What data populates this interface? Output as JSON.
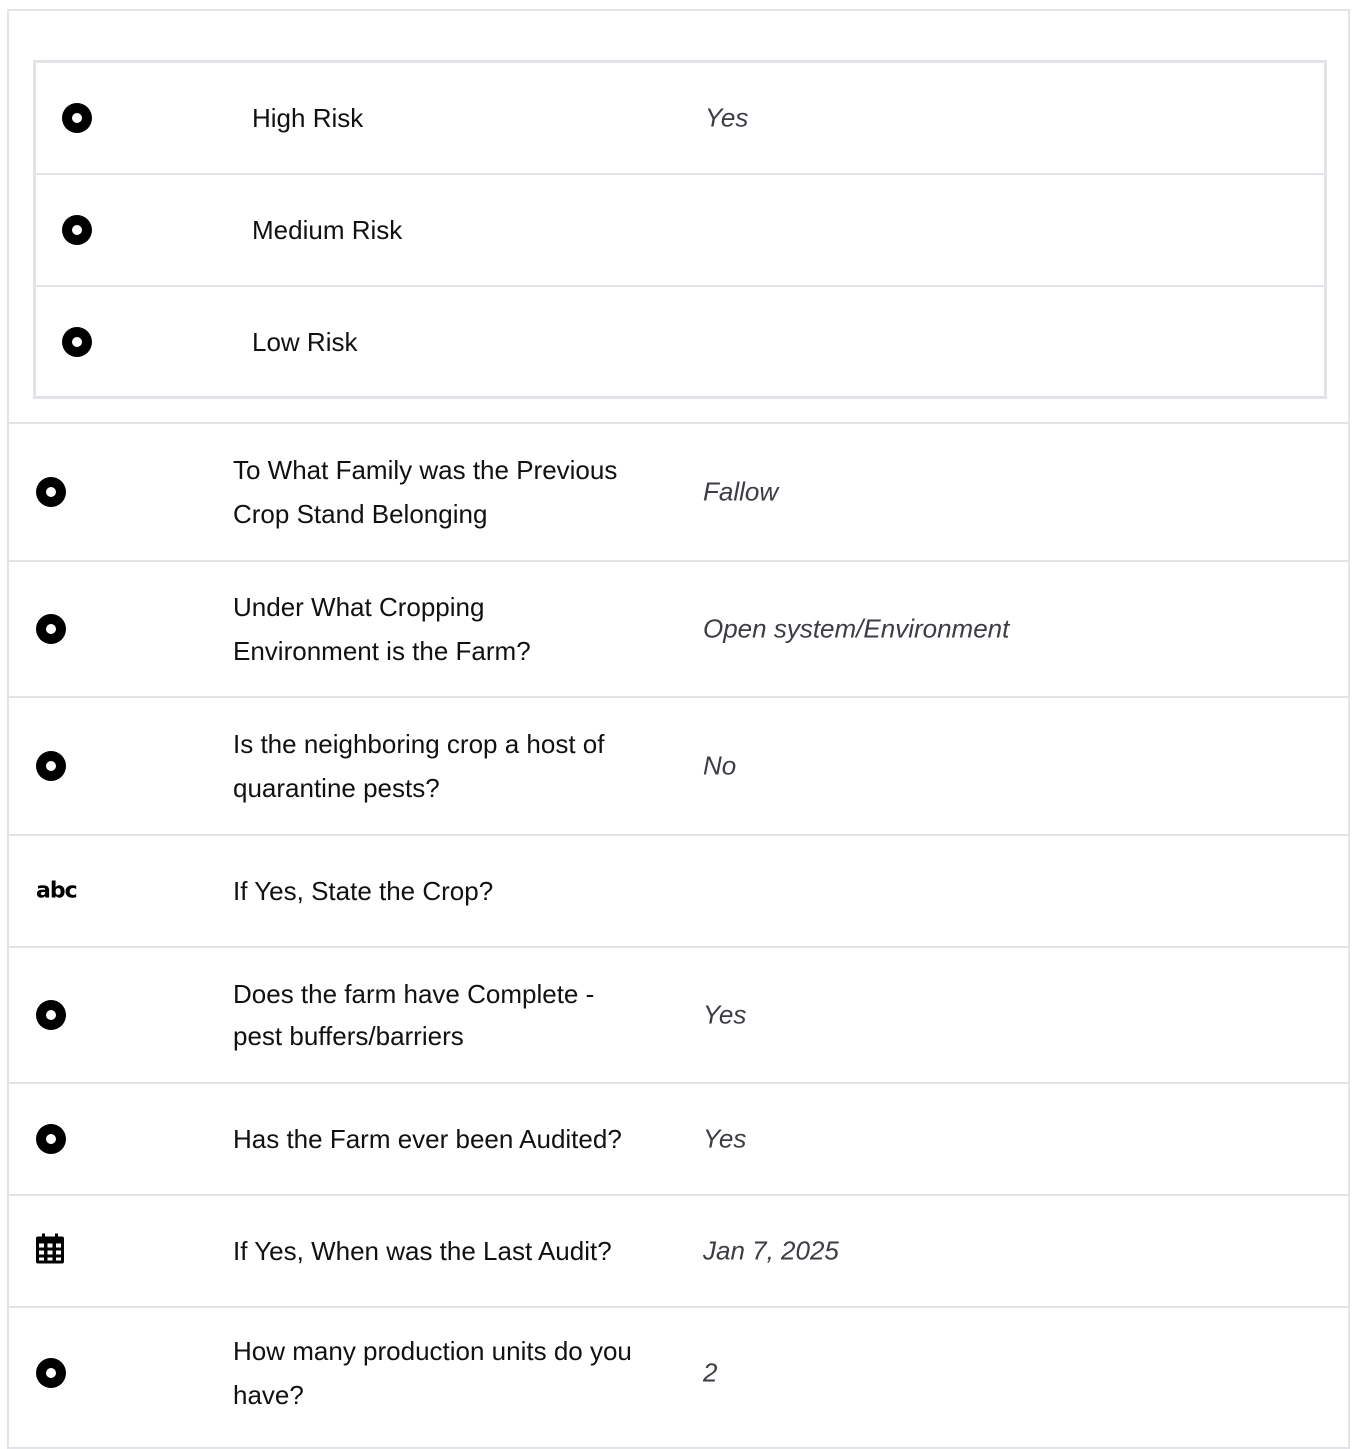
{
  "nested_options": [
    {
      "label": "High Risk",
      "value": "Yes",
      "icon": "radio-icon"
    },
    {
      "label": "Medium Risk",
      "value": "",
      "icon": "radio-icon"
    },
    {
      "label": "Low Risk",
      "value": "",
      "icon": "radio-icon"
    }
  ],
  "questions": [
    {
      "label": "To What Family was the Previous Crop Stand Belonging",
      "value": "Fallow",
      "icon": "radio-icon"
    },
    {
      "label": "Under What Cropping Environment is the Farm?",
      "value": "Open system/Environment",
      "icon": "radio-icon"
    },
    {
      "label": "Is the neighboring crop a host of quarantine pests?",
      "value": "No",
      "icon": "radio-icon"
    },
    {
      "label": "If Yes, State the Crop?",
      "value": "",
      "icon": "text-icon",
      "icon_text": "abc"
    },
    {
      "label": "Does the farm have Complete -pest buffers/barriers",
      "value": "Yes",
      "icon": "radio-icon"
    },
    {
      "label": "Has the Farm ever been Audited?",
      "value": "Yes",
      "icon": "radio-icon"
    },
    {
      "label": "If Yes, When was the Last Audit?",
      "value": "Jan 7, 2025",
      "icon": "calendar-icon"
    },
    {
      "label": "How many production units do you have?",
      "value": "2",
      "icon": "radio-icon"
    }
  ]
}
